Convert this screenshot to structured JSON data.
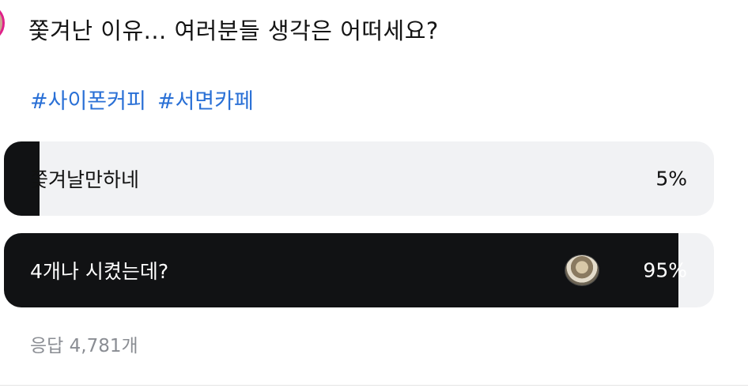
{
  "post": {
    "title": "쫓겨난 이유... 여러분들 생각은 어떠세요?",
    "hashtags": [
      "#사이폰커피",
      "#서면카페"
    ]
  },
  "poll": {
    "options": [
      {
        "label": "쫓겨날만하네",
        "percent_text": "5%",
        "percent": 5,
        "selected": false
      },
      {
        "label": "4개나 시켰는데?",
        "percent_text": "95%",
        "percent": 95,
        "selected": true
      }
    ],
    "response_count": "응답 4,781개"
  },
  "colors": {
    "hashtag": "#2a70d6",
    "fill": "#111214",
    "track": "#f1f2f4",
    "avatar_ring": "#e0218a",
    "muted_text": "#8a8d93"
  },
  "icons": {
    "author_avatar": "avatar-image",
    "voter_thumbnail": "voter-avatar-image"
  }
}
